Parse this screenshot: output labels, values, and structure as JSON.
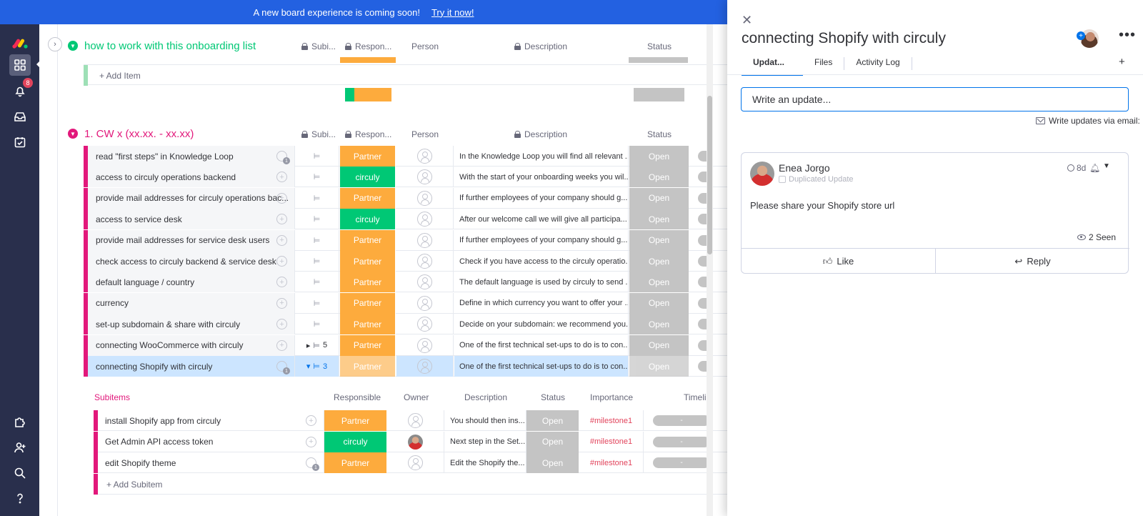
{
  "banner": {
    "text": "A new board experience is coming soon!",
    "link": "Try it now!"
  },
  "nav": {
    "notifications_count": "8"
  },
  "group1": {
    "title": "how to work with this onboarding list",
    "color": "#00c875",
    "add_item": "+ Add Item"
  },
  "group2": {
    "title": "1. CW x (xx.xx. - xx.xx)",
    "color": "#e2187b"
  },
  "columns": {
    "subitems": "Subi...",
    "responsible": "Respon...",
    "person": "Person",
    "description": "Description",
    "status": "Status"
  },
  "colors": {
    "partner": "#fdab3d",
    "circuly": "#00c875",
    "status": "#c4c4c4",
    "accent": "#0073ea"
  },
  "rows": [
    {
      "name": "read \"first steps\" in Knowledge Loop",
      "resp": "Partner",
      "desc": "In the Knowledge Loop you will find all relevant ...",
      "status": "Open",
      "comments": "1",
      "sub": ""
    },
    {
      "name": "access to circuly operations backend",
      "resp": "circuly",
      "desc": "With the start of your onboarding weeks you wil...",
      "status": "Open",
      "comments": "",
      "sub": ""
    },
    {
      "name": "provide mail addresses for circuly operations bac...",
      "resp": "Partner",
      "desc": "If further employees of your company should g...",
      "status": "Open",
      "comments": "",
      "sub": ""
    },
    {
      "name": "access to service desk",
      "resp": "circuly",
      "desc": "After our welcome call we will give all participa...",
      "status": "Open",
      "comments": "",
      "sub": ""
    },
    {
      "name": "provide mail addresses for service desk users",
      "resp": "Partner",
      "desc": "If further employees of your company should g...",
      "status": "Open",
      "comments": "",
      "sub": ""
    },
    {
      "name": "check access to circuly backend & service desk",
      "resp": "Partner",
      "desc": "Check if you have access to the circuly operatio...",
      "status": "Open",
      "comments": "",
      "sub": ""
    },
    {
      "name": "default language / country",
      "resp": "Partner",
      "desc": "The default language is used by circuly to send ...",
      "status": "Open",
      "comments": "",
      "sub": ""
    },
    {
      "name": "currency",
      "resp": "Partner",
      "desc": "Define in which currency you want to offer your ...",
      "status": "Open",
      "comments": "",
      "sub": ""
    },
    {
      "name": "set-up subdomain & share with circuly",
      "resp": "Partner",
      "desc": "Decide on your subdomain: we recommend you...",
      "status": "Open",
      "comments": "",
      "sub": ""
    },
    {
      "name": "connecting WooCommerce with circuly",
      "resp": "Partner",
      "desc": "One of the first technical set-ups to do is to con...",
      "status": "Open",
      "comments": "",
      "sub": "5"
    },
    {
      "name": "connecting Shopify with circuly",
      "resp": "Partner",
      "desc": "One of the first technical set-ups to do is to con...",
      "status": "Open",
      "comments": "1",
      "sub": "3"
    }
  ],
  "subitems": {
    "headers": [
      "Subitems",
      "Responsible",
      "Owner",
      "Description",
      "Status",
      "Importance",
      "Timelin"
    ],
    "rows": [
      {
        "name": "install Shopify app from circuly",
        "resp": "Partner",
        "desc": "You should then ins...",
        "status": "Open",
        "importance": "#milestone1",
        "timeline": "-",
        "comments": ""
      },
      {
        "name": "Get Admin API access token",
        "resp": "circuly",
        "desc": "Next step in the Set...",
        "status": "Open",
        "importance": "#milestone1",
        "timeline": "-",
        "comments": ""
      },
      {
        "name": "edit Shopify theme",
        "resp": "Partner",
        "desc": "Edit the Shopify the...",
        "status": "Open",
        "importance": "#milestone1",
        "timeline": "-",
        "comments": "1"
      }
    ],
    "add": "+ Add Subitem"
  },
  "panel": {
    "title": "connecting Shopify with circuly",
    "tabs": [
      "Updat...",
      "Files",
      "Activity Log"
    ],
    "input_placeholder": "Write an update...",
    "email_link": "Write updates via email:",
    "update": {
      "author": "Enea Jorgo",
      "tag": "Duplicated Update",
      "time": "8d",
      "body": "Please share your Shopify store url",
      "seen": "2 Seen",
      "like": "Like",
      "reply": "Reply"
    }
  }
}
